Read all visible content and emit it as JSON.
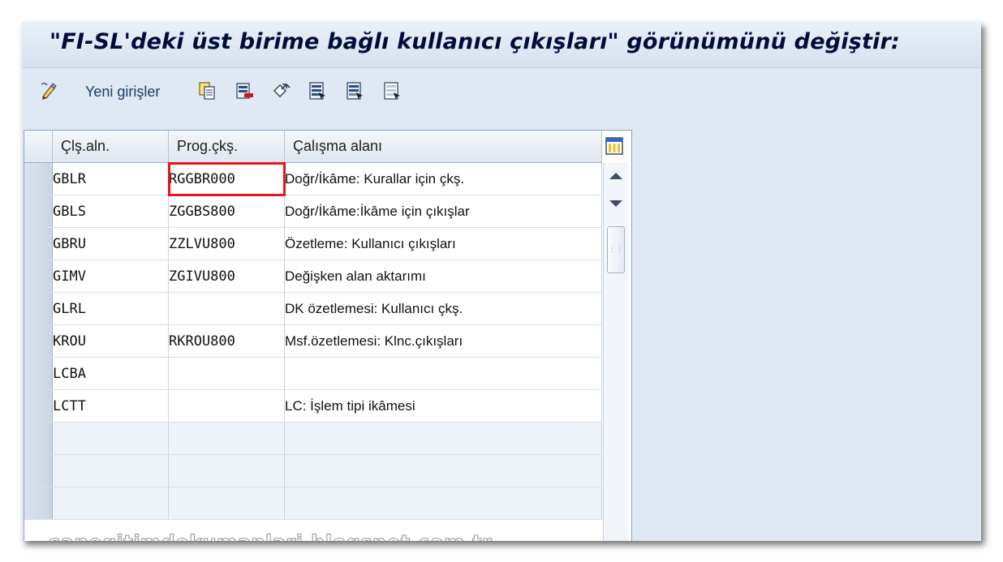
{
  "window": {
    "title": "\"FI-SL'deki üst birime bağlı kullanıcı çıkışları\" görünümünü değiştir:"
  },
  "toolbar": {
    "new_entries_label": "Yeni girişler",
    "icons": [
      "display-change-icon",
      "copy-icon",
      "delete-icon",
      "undo-icon",
      "select-all-icon",
      "select-block-icon",
      "deselect-all-icon"
    ]
  },
  "table": {
    "columns": [
      "Çlş.aln.",
      "Prog.çkş.",
      "Çalışma alanı"
    ],
    "rows": [
      {
        "area": "GBLR",
        "program": "RGGBR000",
        "description": "Doğr/İkâme: Kurallar için çkş."
      },
      {
        "area": "GBLS",
        "program": "ZGGBS800",
        "description": "Doğr/İkâme:İkâme için çıkışlar"
      },
      {
        "area": "GBRU",
        "program": "ZZLVU800",
        "description": "Özetleme: Kullanıcı çıkışları"
      },
      {
        "area": "GIMV",
        "program": "ZGIVU800",
        "description": "Değişken alan aktarımı"
      },
      {
        "area": "GLRL",
        "program": "",
        "description": "DK özetlemesi: Kullanıcı çkş."
      },
      {
        "area": "KROU",
        "program": "RKROU800",
        "description": "Msf.özetlemesi: Klnc.çıkışları"
      },
      {
        "area": "LCBA",
        "program": "",
        "description": ""
      },
      {
        "area": "LCTT",
        "program": "",
        "description": "LC: İşlem tipi ikâmesi"
      }
    ],
    "highlighted_cell": {
      "row": 0,
      "column": "program",
      "color": "#e8141b"
    }
  },
  "watermark": "sapegitimdokumanlari.blogspot.com.tr",
  "colors": {
    "title_text": "#000c3a",
    "toolbar_label": "#1d3e6a",
    "window_bg": "#dfe8f3",
    "highlight": "#e8141b"
  }
}
